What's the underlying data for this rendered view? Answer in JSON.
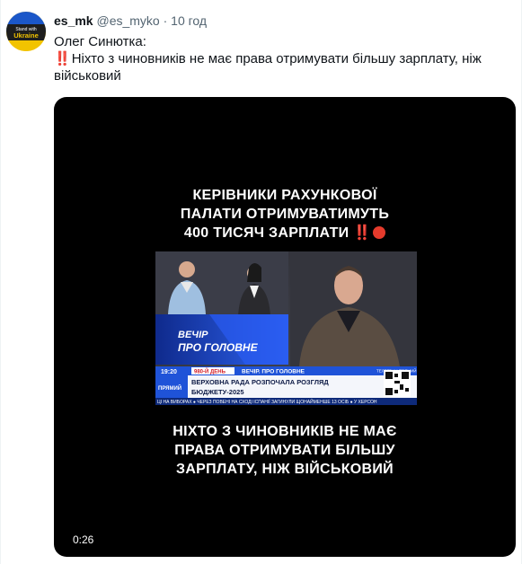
{
  "author": {
    "display_name": "es_mk",
    "handle": "@es_myko",
    "separator": "·",
    "time": "10 год",
    "avatar_text": [
      "Stand with",
      "Ukraine"
    ]
  },
  "tweet": {
    "line1": "Олег Синютка:",
    "line2_emoji": "‼️",
    "line2": "Ніхто з чиновників не має права отримувати більшу зарплату, ніж військовий"
  },
  "video": {
    "headline_top": [
      "КЕРІВНИКИ РАХУНКОВОЇ",
      "ПАЛАТИ ОТРИМУВАТИМУТЬ",
      "400 ТИСЯЧ ЗАРПЛАТИ"
    ],
    "headline_top_emoji": "‼️",
    "headline_bottom": [
      "НІХТО З ЧИНОВНИКІВ НЕ МАЄ",
      "ПРАВА ОТРИМУВАТИ БІЛЬШУ",
      "ЗАРПЛАТУ, НІЖ ВІЙСЬКОВИЙ"
    ],
    "duration": "0:26",
    "frame": {
      "show_title_1": "ВЕЧІР",
      "show_title_2": "ПРО ГОЛОВНЕ",
      "clock": "19:20",
      "day_label": "980-Й ДЕНЬ",
      "program_label": "ВЕЧІР. ПРО ГОЛОВНЕ",
      "telegram_label": "ТЕЛЕГРАМ ПРЯМИЙ",
      "live_label": "ПРЯМИЙ",
      "headline_1": "ВЕРХОВНА РАДА РОЗПОЧАЛА РОЗГЛЯД",
      "headline_2": "БЮДЖЕТУ-2025",
      "ticker": "ЦІ НА ВИБОРАХ  ● ЧЕРЕЗ ПОВЕНІ НА СХОДІ ІСПАНІЇ ЗАГИНУЛИ ЩОНАЙМЕНШЕ 13 ОСІБ  ● У ХЕРСОН"
    }
  },
  "colors": {
    "accent_red": "#e0245e",
    "name": "#0f1419",
    "meta": "#536471",
    "tv_blue": "#1d4fd6",
    "avatar_yellow": "#f2c300",
    "avatar_blue": "#1b57c9"
  }
}
